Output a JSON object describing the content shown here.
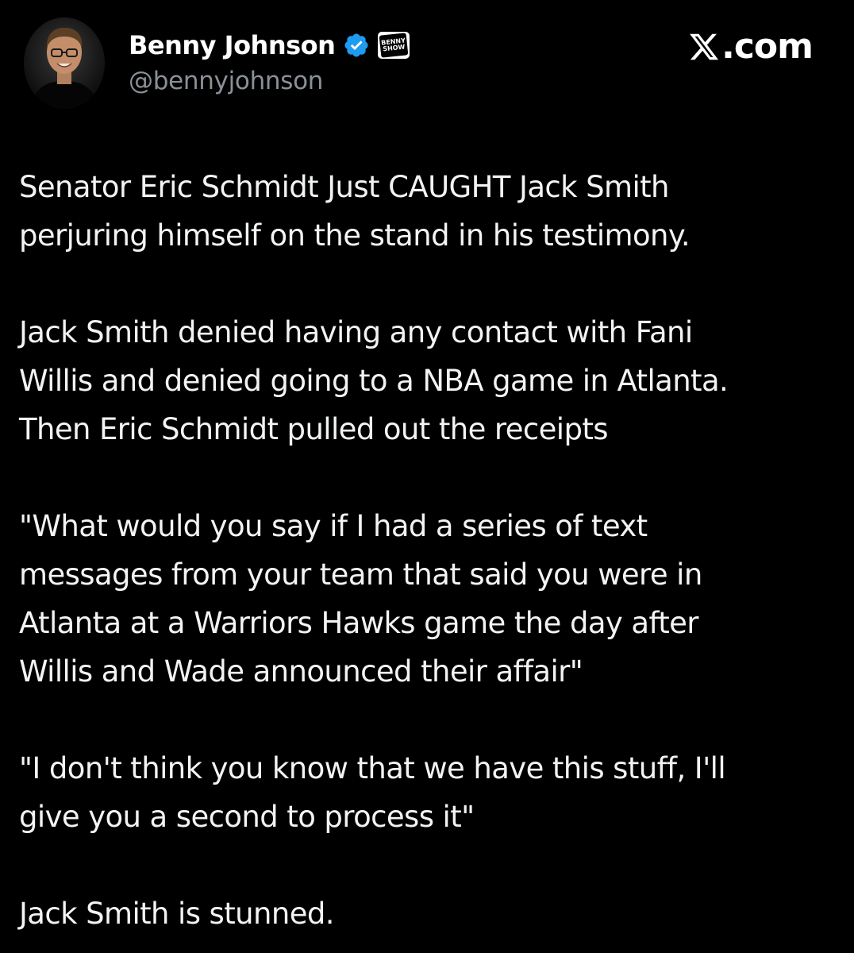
{
  "author": {
    "display_name": "Benny Johnson",
    "handle": "@bennyjohnson",
    "verified_icon": "verified-badge-icon",
    "show_badge_line1": "BENNY",
    "show_badge_line2": "SHOW"
  },
  "site": {
    "label": ".com",
    "logo_icon": "x-logo-icon"
  },
  "colors": {
    "background": "#000000",
    "text": "#e7e9ea",
    "handle": "#8b9097",
    "verified": "#1d9bf0"
  },
  "tweet": {
    "paragraphs": [
      "Senator Eric Schmidt Just CAUGHT Jack Smith\nperjuring himself on the stand in his testimony.",
      "Jack Smith denied having any contact with Fani\nWillis and denied going to a NBA game in Atlanta.\nThen Eric Schmidt pulled out the receipts",
      "\"What would you say if I had a series of text\nmessages from your team that said you were in\nAtlanta at a Warriors Hawks game the day after\nWillis and Wade announced their affair\"",
      "\"I don't think you know that we have this stuff, I'll\ngive you a second to process it\"",
      "Jack Smith is stunned."
    ]
  }
}
